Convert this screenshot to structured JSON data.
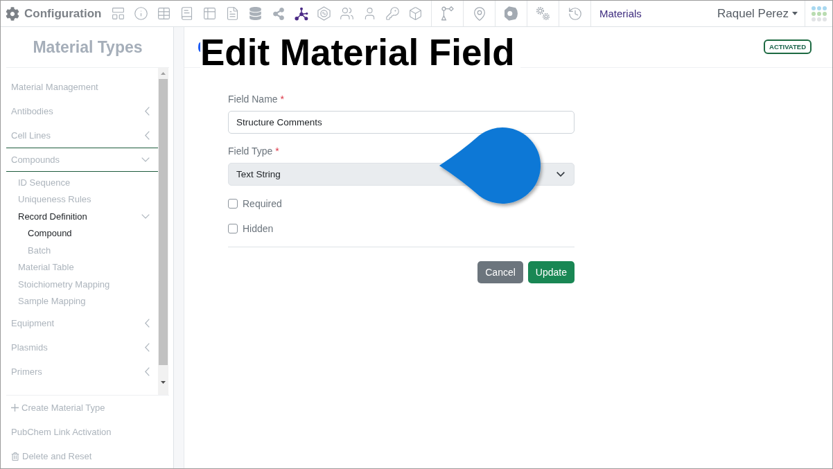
{
  "header": {
    "title": "Configuration",
    "icons": [
      {
        "selected": false
      },
      {
        "selected": false
      },
      {
        "selected": false
      },
      {
        "selected": false
      },
      {
        "selected": false
      },
      {
        "selected": false
      },
      {
        "selected": false
      },
      {
        "selected": false
      },
      {
        "selected": true
      },
      {
        "selected": false
      },
      {
        "selected": false
      },
      {
        "selected": false
      },
      {
        "selected": false
      },
      {
        "selected": false
      }
    ],
    "modules": [
      {
        "selected": false
      },
      {
        "selected": false
      },
      {
        "selected": false
      },
      {
        "selected": false
      },
      {
        "selected": false
      }
    ],
    "nav_link": "Materials",
    "user": "Raquel Perez"
  },
  "sidebar": {
    "title": "Material Types",
    "items": [
      {
        "label": "Material Management",
        "selected": false
      },
      {
        "label": "Antibodies",
        "expanded": false
      },
      {
        "label": "Cell Lines",
        "expanded": false
      },
      {
        "label": "Compounds",
        "expanded": true,
        "children": [
          {
            "label": "ID Sequence",
            "selected": false
          },
          {
            "label": "Uniqueness Rules",
            "selected": false
          },
          {
            "label": "Record Definition",
            "expanded": true,
            "children": [
              {
                "label": "Compound",
                "selected": true
              },
              {
                "label": "Batch",
                "selected": false
              }
            ]
          },
          {
            "label": "Material Table",
            "selected": false
          },
          {
            "label": "Stoichiometry Mapping",
            "selected": false
          },
          {
            "label": "Sample Mapping",
            "selected": false
          }
        ]
      },
      {
        "label": "Equipment",
        "expanded": false
      },
      {
        "label": "Plasmids",
        "expanded": false
      },
      {
        "label": "Primers",
        "expanded": false
      }
    ],
    "actions": [
      {
        "label": "Create Material Type",
        "kind": "create"
      },
      {
        "label": "PubChem Link Activation",
        "kind": "link"
      },
      {
        "label": "Delete and Reset",
        "kind": "delete"
      }
    ]
  },
  "page": {
    "title": "Edit Material Field",
    "status": "ACTIVATED"
  },
  "form": {
    "fields": [
      {
        "kind": "text",
        "label": "Field Name",
        "required_mark": "*",
        "value": "Structure Comments"
      },
      {
        "kind": "select",
        "label": "Field Type",
        "required_mark": "*",
        "value": "Text String"
      }
    ],
    "checkboxes": [
      {
        "label": "Required",
        "checked": false
      },
      {
        "label": "Hidden",
        "checked": false
      }
    ],
    "buttons": [
      {
        "label": "Cancel",
        "kind": "secondary"
      },
      {
        "label": "Update",
        "kind": "primary"
      }
    ]
  }
}
